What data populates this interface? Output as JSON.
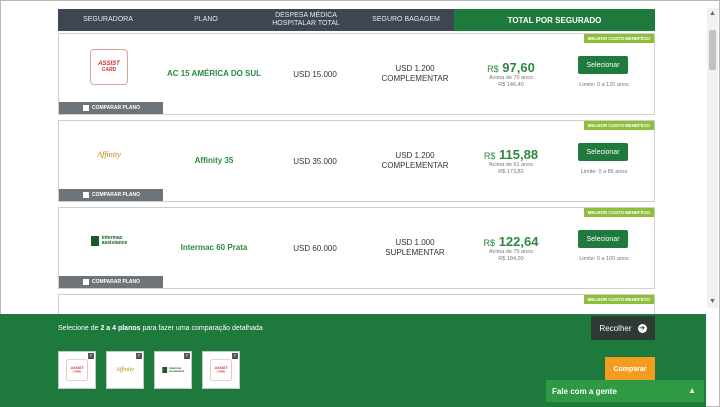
{
  "table_header": {
    "seguradora": "SEGURADORA",
    "plano": "PLANO",
    "despesa": "DESPESA MÉDICA HOSPITALAR TOTAL",
    "bagagem": "SEGURO BAGAGEM",
    "total": "TOTAL POR SEGURADO"
  },
  "plans": [
    {
      "name": "AC 15 AMÉRICA DO SUL",
      "medical": "USD 15.000",
      "baggage_1": "USD 1.200",
      "baggage_2": "COMPLEMENTAR",
      "currency": "R$",
      "price": "97,60",
      "price_note": "Acima de 70 anos",
      "price_alt": "R$ 146,40",
      "select_label": "Selecionar",
      "limit": "Limite: 0 a 120 anos",
      "badge": "MELHOR CUSTO-BENEFÍCIO",
      "compare_label": "COMPARAR PLANO",
      "logo_line1": "ASSIST",
      "logo_line2": "CARD"
    },
    {
      "name": "Affinity 35",
      "medical": "USD 35.000",
      "baggage_1": "USD 1.200",
      "baggage_2": "COMPLEMENTAR",
      "currency": "R$",
      "price": "115,88",
      "price_note": "Acima de 61 anos",
      "price_alt": "R$ 173,82",
      "select_label": "Selecionar",
      "limit": "Limite: 0 a 85 anos",
      "badge": "MELHOR CUSTO-BENEFÍCIO",
      "compare_label": "COMPARAR PLANO",
      "logo_text": "Affinity"
    },
    {
      "name": "Intermac 60 Prata",
      "medical": "USD 60.000",
      "baggage_1": "USD 1.000",
      "baggage_2": "SUPLEMENTAR",
      "currency": "R$",
      "price": "122,64",
      "price_note": "Acima de 75 anos",
      "price_alt": "R$ 184,00",
      "select_label": "Selecionar",
      "limit": "Limite: 0 a 100 anos",
      "badge": "MELHOR CUSTO-BENEFÍCIO",
      "compare_label": "COMPARAR PLANO",
      "logo_line1": "intermac",
      "logo_line2": "assistance"
    }
  ],
  "partial_card": {
    "badge": "MELHOR CUSTO-BENEFÍCIO"
  },
  "compare_panel": {
    "text_prefix": "Selecione de",
    "text_bold": "2 a 4 planos",
    "text_suffix": "para fazer uma comparação detalhada",
    "collapse_label": "Recolher",
    "compare_button": "Comparar",
    "thumb_check": "✓"
  },
  "chat": {
    "label": "Fale com a gente"
  },
  "icons": {
    "collapse": "arrow-right-circle-icon",
    "chat": "chevron-up-icon"
  },
  "colors": {
    "brand_green": "#1f7a3d",
    "price_green": "#2a8a3e",
    "badge_green": "#8fbf3a",
    "header_dark": "#3e4654",
    "compare_orange": "#f39c1f"
  }
}
